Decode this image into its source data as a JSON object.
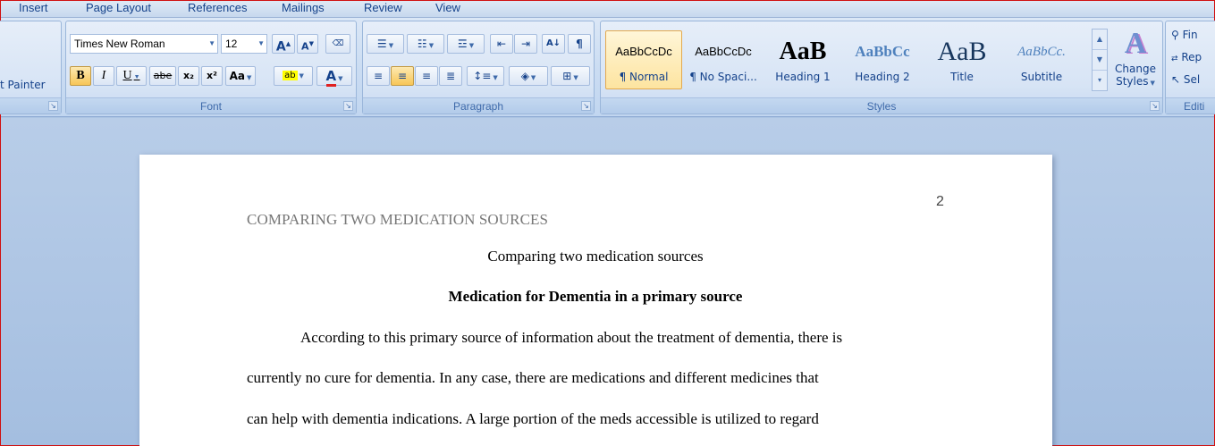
{
  "menu": {
    "tabs": [
      "Insert",
      "Page Layout",
      "References",
      "Mailings",
      "Review",
      "View"
    ]
  },
  "clipboard": {
    "format_painter": "t Painter"
  },
  "font_group": {
    "label": "Font",
    "font_name": "Times New Roman",
    "font_size": "12",
    "grow": "A",
    "shrink": "A",
    "bold": "B",
    "italic": "I",
    "underline": "U",
    "strike": "abe",
    "subscript": "x₂",
    "superscript": "x²",
    "change_case": "Aa",
    "highlight": "ab",
    "font_color": "A"
  },
  "paragraph_group": {
    "label": "Paragraph",
    "show_marks": "¶",
    "sort": "A↓"
  },
  "styles_group": {
    "label": "Styles",
    "items": [
      {
        "preview": "AaBbCcDc",
        "name": "¶ Normal"
      },
      {
        "preview": "AaBbCcDc",
        "name": "¶ No Spaci..."
      },
      {
        "preview": "AaB",
        "name": "Heading 1"
      },
      {
        "preview": "AaBbCc",
        "name": "Heading 2"
      },
      {
        "preview": "AaB",
        "name": "Title"
      },
      {
        "preview": "AaBbCc.",
        "name": "Subtitle"
      }
    ],
    "change_styles_line1": "Change",
    "change_styles_line2": "Styles"
  },
  "editing_group": {
    "label": "Editi",
    "find": "Fin",
    "replace": "Rep",
    "select": "Sel"
  },
  "document": {
    "page_number": "2",
    "running_header": "COMPARING TWO MEDICATION SOURCES",
    "title": "Comparing two medication sources",
    "heading": "Medication for Dementia in a primary source",
    "lines": [
      "According to this primary  source  of information about the treatment of dementia, there is",
      "currently no cure for dementia. In any case, there are medications and different medicines that",
      "can help with dementia indications.  A large portion of the meds accessible  is utilized to regard"
    ]
  },
  "colors": {
    "ribbon_text": "#15428b",
    "accent_active": "#f7c657",
    "heading2": "#4f81bd",
    "workspace": "#abc4e3"
  }
}
